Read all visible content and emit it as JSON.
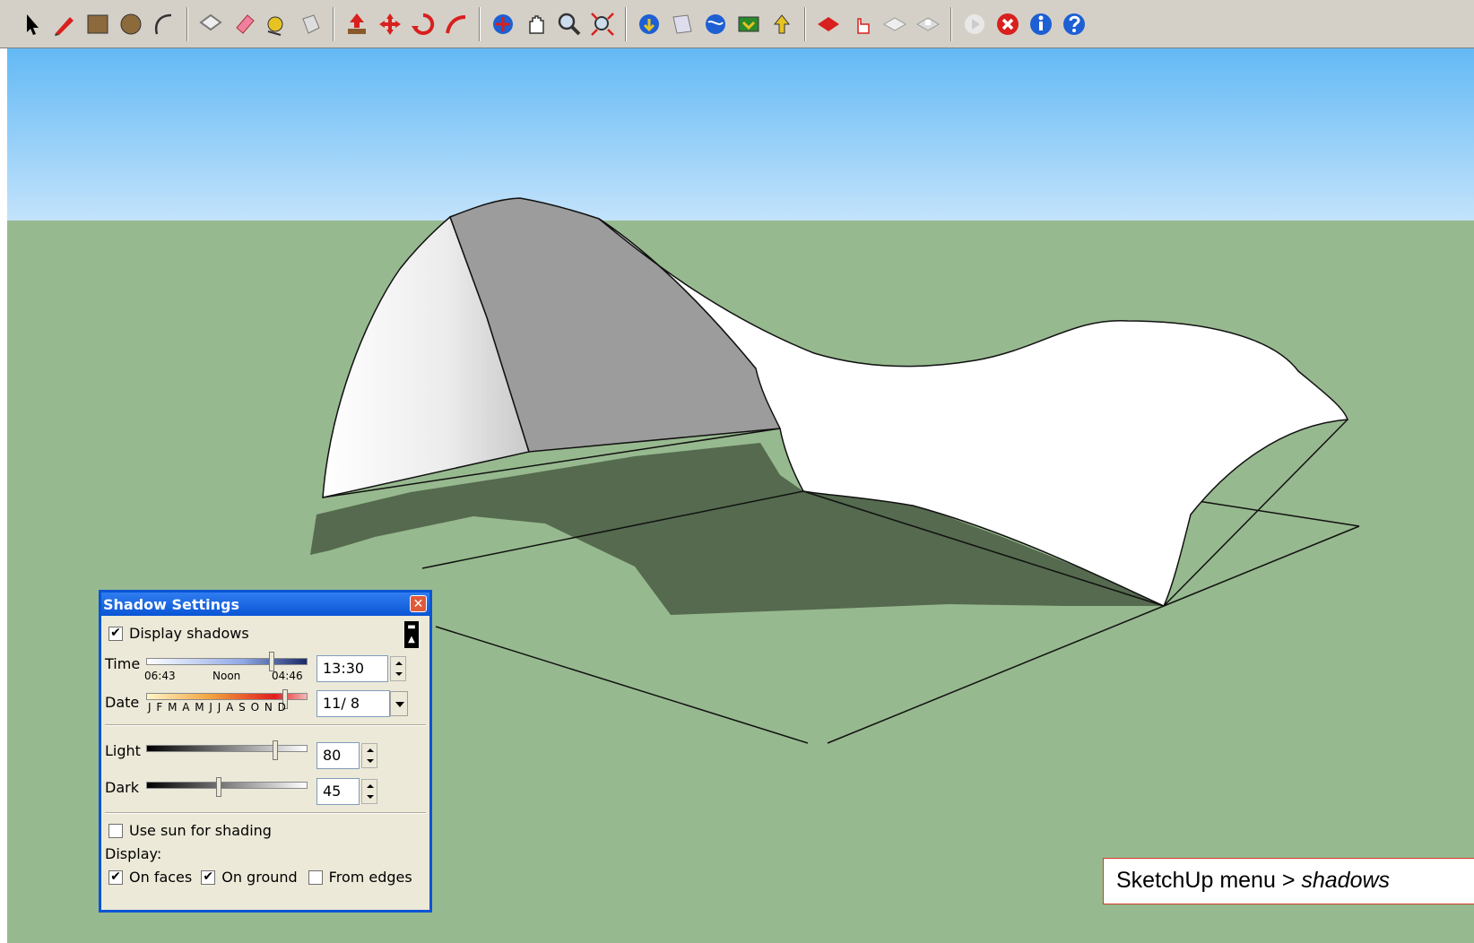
{
  "toolbar": {
    "groups": [
      [
        "select-icon",
        "pencil-icon",
        "rectangle-icon",
        "circle-icon",
        "arc-icon"
      ],
      [
        "make-component-icon",
        "eraser-icon",
        "tape-measure-icon",
        "paint-bucket-icon"
      ],
      [
        "push-pull-icon",
        "move-icon",
        "rotate-icon",
        "follow-me-icon"
      ],
      [
        "orbit-icon",
        "pan-icon",
        "zoom-icon",
        "zoom-extents-icon"
      ],
      [
        "get-models-icon",
        "share-model-icon",
        "google-earth-icon",
        "get-photo-icon",
        "upload-icon"
      ],
      [
        "paint-ruby-icon",
        "hand-pointer-icon",
        "layer-icon",
        "section-icon"
      ],
      [
        "play-icon",
        "stop-icon",
        "info-icon",
        "help-icon"
      ]
    ],
    "colors": {
      "red": "#d8201e",
      "blue": "#1e5fd3",
      "brown": "#8a5a2b",
      "yellow": "#e7c322",
      "green": "#2b8a2b"
    }
  },
  "scene": {
    "sky_top": "#63b9f5",
    "sky_bottom": "#c3e3fb",
    "ground": "#97b98f",
    "shadow": "#556a4e"
  },
  "dialog": {
    "title": "Shadow Settings",
    "display_shadows": {
      "label": "Display shadows",
      "checked": true
    },
    "time": {
      "label": "Time",
      "start": "06:43",
      "mid": "Noon",
      "end": "04:46",
      "value": "13:30",
      "fraction": 0.78
    },
    "date": {
      "label": "Date",
      "months": "J F M A M J J A S O N D",
      "value": "11/ 8",
      "fraction": 0.86
    },
    "light": {
      "label": "Light",
      "value": "80",
      "fraction": 0.8
    },
    "dark": {
      "label": "Dark",
      "value": "45",
      "fraction": 0.45
    },
    "use_sun": {
      "label": "Use sun for shading",
      "checked": false
    },
    "display_label": "Display:",
    "on_faces": {
      "label": "On faces",
      "checked": true
    },
    "on_ground": {
      "label": "On ground",
      "checked": true
    },
    "from_edges": {
      "label": "From edges",
      "checked": false
    }
  },
  "caption": {
    "prefix": "SketchUp menu > ",
    "emphasis": "shadows"
  }
}
